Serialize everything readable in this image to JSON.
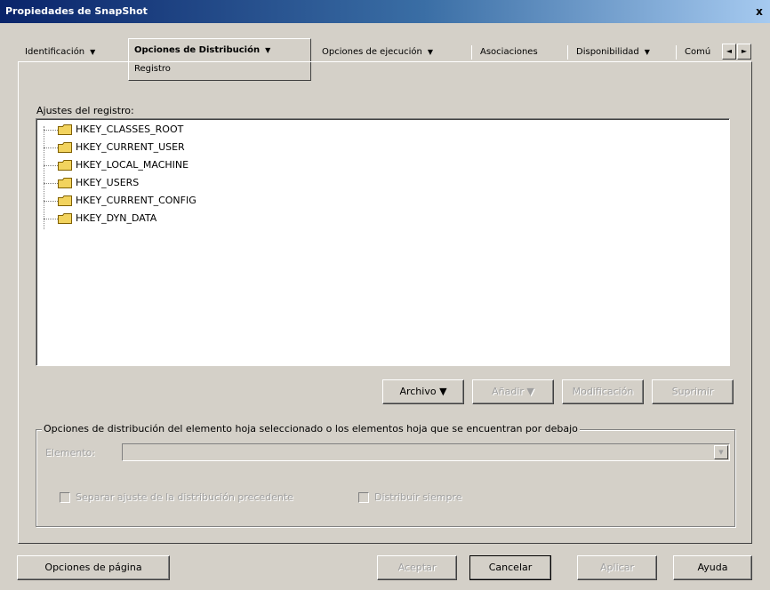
{
  "window": {
    "title": "Propiedades de SnapShot",
    "close_label": "x"
  },
  "tabs": [
    {
      "label": "Identificación",
      "has_menu": true
    },
    {
      "label": "Opciones de Distribución",
      "has_menu": true
    },
    {
      "label": "Opciones de ejecución",
      "has_menu": true
    },
    {
      "label": "Asociaciones",
      "has_menu": false
    },
    {
      "label": "Disponibilidad",
      "has_menu": true
    },
    {
      "label": "Comú",
      "has_menu": false
    }
  ],
  "active_subtab": "Registro",
  "menu_arrow": "▼",
  "scroll_left": "◄",
  "scroll_right": "►",
  "registry": {
    "label": "Ajustes del registro:",
    "keys": [
      "HKEY_CLASSES_ROOT",
      "HKEY_CURRENT_USER",
      "HKEY_LOCAL_MACHINE",
      "HKEY_USERS",
      "HKEY_CURRENT_CONFIG",
      "HKEY_DYN_DATA"
    ]
  },
  "registry_buttons": {
    "archivo": "Archivo ▼",
    "anadir": "Añadir ▼",
    "modificacion": "Modificación",
    "suprimir": "Suprimir"
  },
  "distribution_group": {
    "legend": "Opciones de distribución del elemento hoja seleccionado o los elementos hoja que se encuentran por debajo",
    "elemento_label": "Elemento:",
    "elemento_value": "",
    "checkbox1_label": "Separar ajuste de la distribución precedente",
    "checkbox2_label": "Distribuir siempre"
  },
  "footer_buttons": {
    "page_options": "Opciones de página",
    "aceptar": "Aceptar",
    "cancelar": "Cancelar",
    "aplicar": "Aplicar",
    "ayuda": "Ayuda"
  },
  "colors": {
    "title_bar_start": "#0a246a",
    "title_bar_end": "#a6caf0",
    "face": "#d4d0c8",
    "folder": "#f2d35e"
  }
}
